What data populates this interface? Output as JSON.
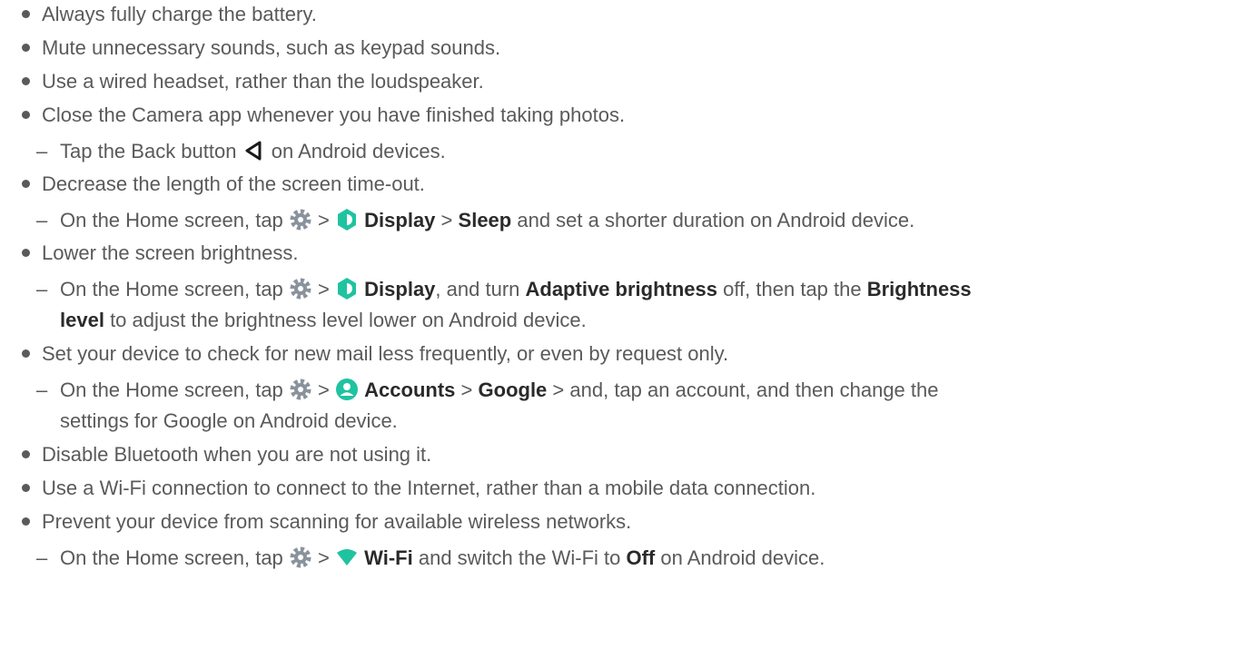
{
  "lines": {
    "l1": "Always fully charge the battery.",
    "l2": "Mute unnecessary sounds, such as keypad sounds.",
    "l3": "Use a wired headset, rather than the loudspeaker.",
    "l4": "Close the Camera app whenever you have finished taking photos.",
    "l4s_a": "Tap the Back button",
    "l4s_b": "on Android devices.",
    "l5": "Decrease the length of the screen time-out.",
    "l5s_a": "On the Home screen, tap",
    "l5s_display": "Display",
    "l5s_sleep": "Sleep",
    "l5s_b": "and set a shorter duration on Android device.",
    "l6": "Lower the screen brightness.",
    "l6s_a": "On the Home screen, tap",
    "l6s_display": "Display",
    "l6s_b": ", and turn",
    "l6s_adaptive": "Adaptive brightness",
    "l6s_c": "off, then tap the",
    "l6s_brightness": "Brightness",
    "l6s_level": "level",
    "l6s_d": "to adjust the brightness level lower on Android device.",
    "l7": "Set your device to check for new mail less frequently, or even by request only.",
    "l7s_a": "On the Home screen, tap",
    "l7s_accounts": "Accounts",
    "l7s_google": "Google",
    "l7s_b": "> and, tap an account, and then change the",
    "l7s_c": "settings for Google on Android device.",
    "l8": "Disable Bluetooth when you are not using it.",
    "l9": "Use a Wi-Fi connection to connect to the Internet, rather than a mobile data connection.",
    "l10": "Prevent your device from scanning for available wireless networks.",
    "l10s_a": "On the Home screen, tap",
    "l10s_wifi": "Wi-Fi",
    "l10s_b": "and switch the Wi-Fi to",
    "l10s_off": "Off",
    "l10s_c": "on Android device."
  },
  "symbols": {
    "dash": "–",
    "gt": ">"
  },
  "icons": {
    "back": "back-triangle-icon",
    "settings": "settings-gear-icon",
    "display": "display-brightness-icon",
    "accounts": "accounts-person-icon",
    "wifi": "wifi-signal-icon"
  },
  "colors": {
    "text": "#5a5a5a",
    "bold": "#2a2a2a",
    "teal": "#1fc3a0",
    "gear": "#8a939c"
  }
}
